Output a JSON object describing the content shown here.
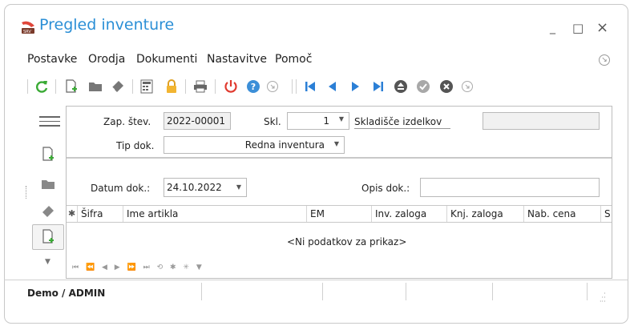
{
  "window": {
    "title": "Pregled inventure",
    "minimize": "_",
    "maximize": "□",
    "close": "×"
  },
  "menu": {
    "items": [
      "Postavke",
      "Orodja",
      "Dokumenti",
      "Nastavitve",
      "Pomoč"
    ]
  },
  "toolbar": {
    "icons": [
      "refresh-icon",
      "new-doc-icon",
      "folder-icon",
      "eraser-icon",
      "calculator-icon",
      "lock-icon",
      "print-icon",
      "power-icon",
      "help-icon",
      "arrow-circle-icon",
      "first-icon",
      "prev-icon",
      "next-icon",
      "last-icon",
      "eject-icon",
      "check-icon",
      "cancel-icon",
      "arrow-circle-icon"
    ]
  },
  "form": {
    "zap_label": "Zap. štev.",
    "zap_value": "2022-00001",
    "skl_label": "Skl.",
    "skl_value": "1",
    "skl_name": "Skladišče izdelkov",
    "tip_label": "Tip dok.",
    "tip_value": "Redna inventura",
    "datum_label": "Datum dok.:",
    "datum_value": "24.10.2022",
    "opis_label": "Opis dok.:",
    "opis_value": ""
  },
  "grid": {
    "columns": [
      "Šifra",
      "Ime artikla",
      "EM",
      "Inv. zaloga",
      "Knj. zaloga",
      "Nab. cena",
      "S"
    ],
    "empty_text": "<Ni podatkov za prikaz>"
  },
  "status": {
    "user": "Demo / ADMIN"
  },
  "colors": {
    "accent": "#2b8fd6",
    "green": "#3aaa35",
    "red": "#e03a2f"
  }
}
